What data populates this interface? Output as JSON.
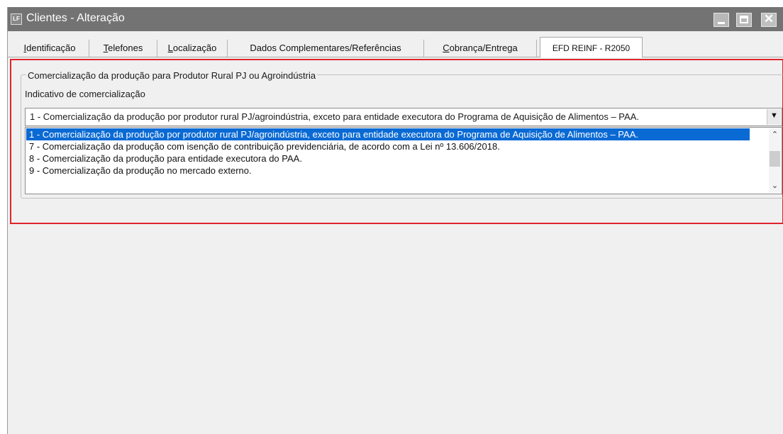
{
  "window": {
    "title": "Clientes - Alteração",
    "app_icon": "app-icon",
    "app_icon_text": "LF",
    "buttons": [
      "minimize",
      "maximize",
      "close"
    ]
  },
  "tabs": [
    {
      "accel": "I",
      "rest": "dentificação"
    },
    {
      "accel": "T",
      "rest": "elefones"
    },
    {
      "accel": "L",
      "rest": "ocalização"
    },
    {
      "accel": "",
      "rest": "Dados Complementares/Referências"
    },
    {
      "accel": "C",
      "rest": "obrança/Entrega"
    },
    {
      "accel": "",
      "rest": "EFD REINF - R2050",
      "active": true
    }
  ],
  "group": {
    "title": "Comercialização da produção para Produtor Rural PJ ou Agroindústria",
    "field_label": "Indicativo de comercialização",
    "selected_value": "1 - Comercialização da produção por produtor rural PJ/agroindústria, exceto para entidade executora do Programa de Aquisição de Alimentos – PAA.",
    "options": [
      "1 - Comercialização da produção por produtor rural PJ/agroindústria, exceto para entidade executora do Programa de Aquisição de Alimentos – PAA.",
      "7 - Comercialização da produção com isenção de contribuição previdenciária, de acordo com a Lei nº 13.606/2018.",
      "8 - Comercialização da produção para entidade executora do PAA.",
      "9 - Comercialização da produção no mercado externo."
    ],
    "selected_index": 0
  },
  "colors": {
    "titlebar": "#737373",
    "selection": "#0a6ad4",
    "highlight_border": "#e0242c",
    "panel": "#f0f0f0"
  }
}
